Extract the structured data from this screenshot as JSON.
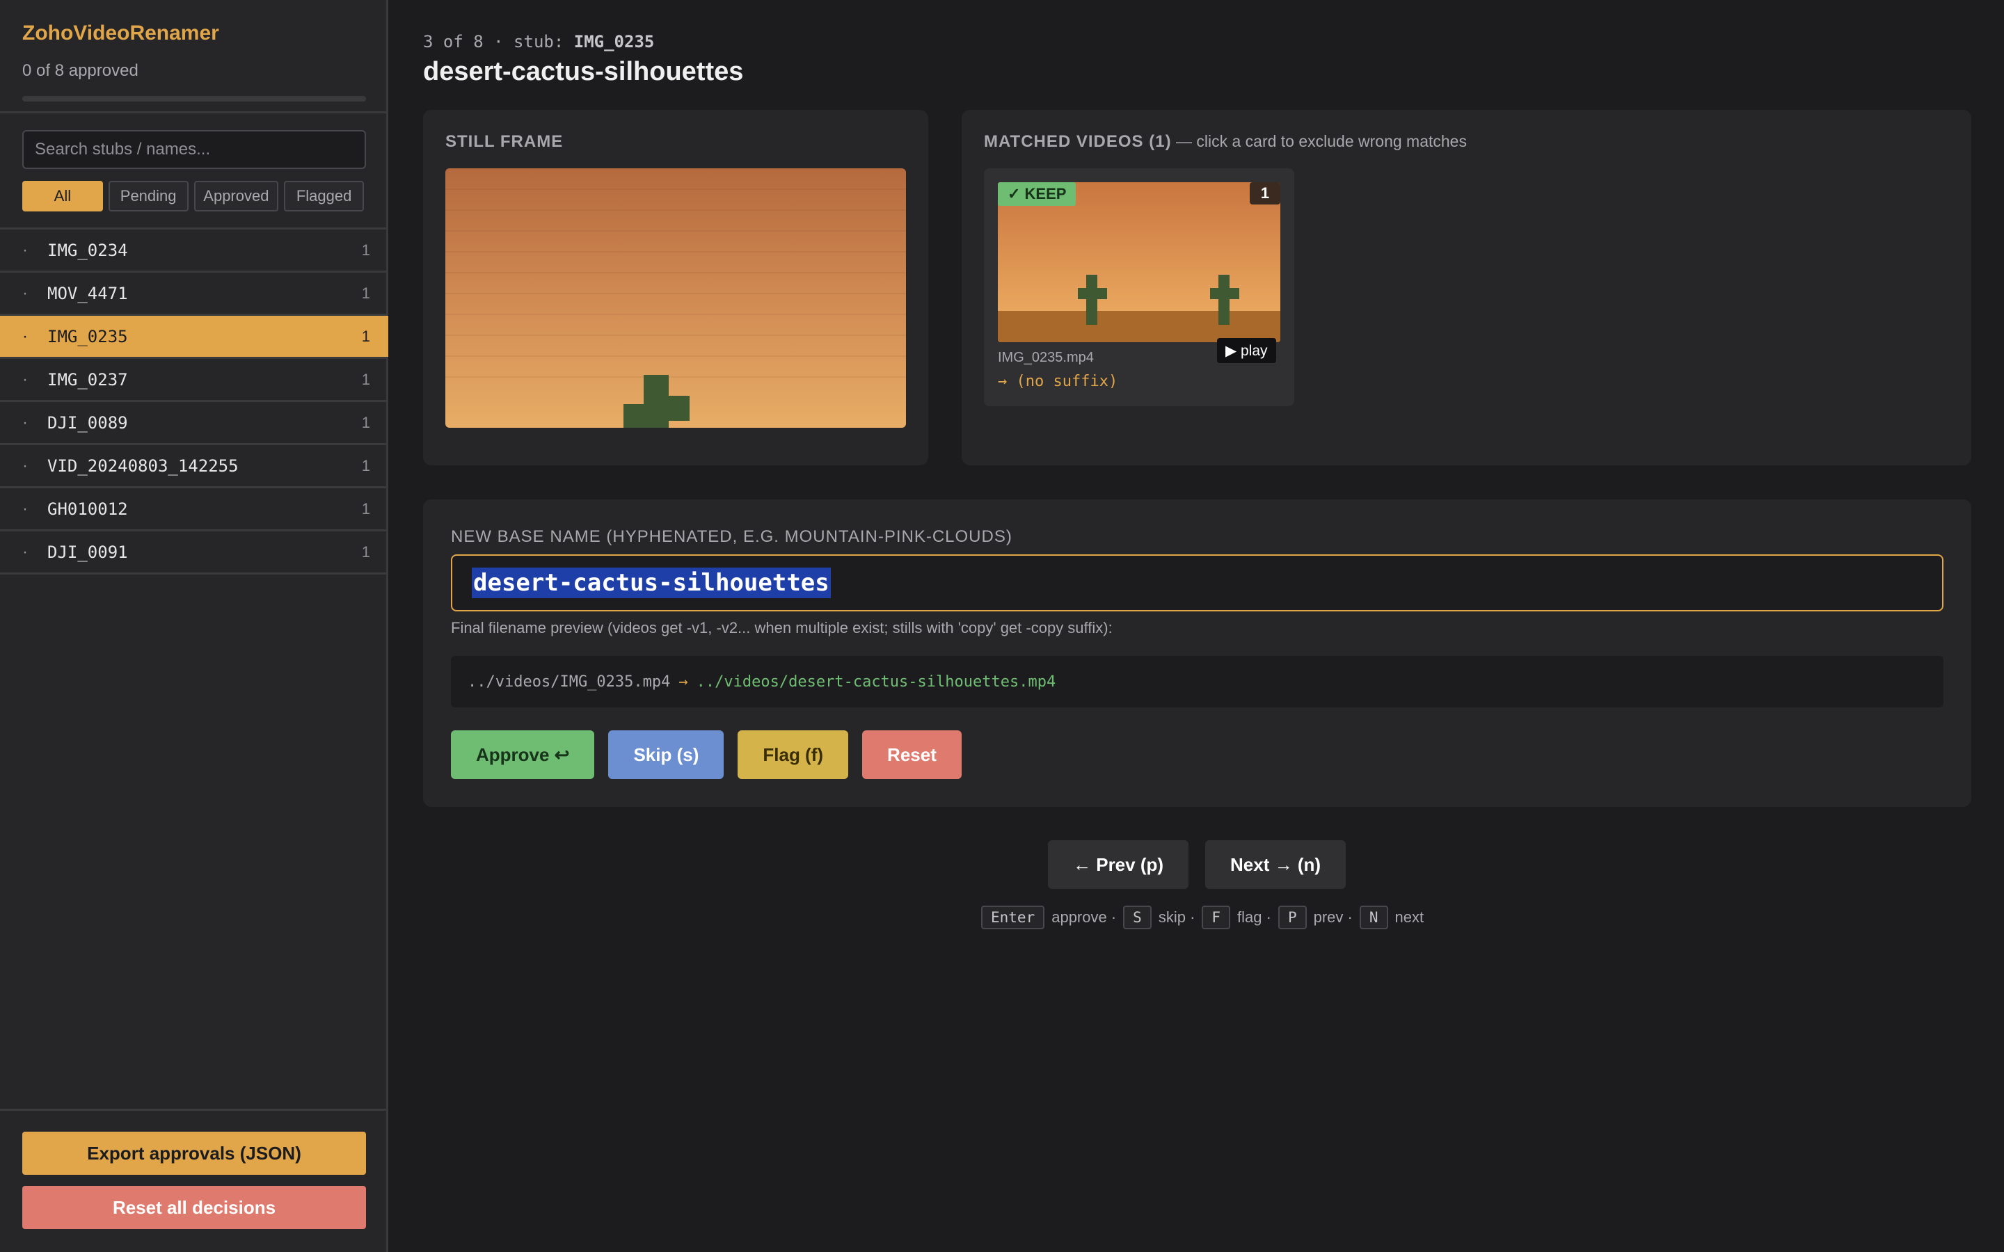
{
  "app": {
    "title": "ZohoVideoRenamer",
    "approved_text": "0 of 8 approved",
    "progress": 0
  },
  "sidebar": {
    "search_placeholder": "Search stubs / names...",
    "filters": [
      "All",
      "Pending",
      "Approved",
      "Flagged"
    ],
    "active_filter": "All",
    "items": [
      {
        "bullet": "·",
        "name": "IMG_0234",
        "count": "1"
      },
      {
        "bullet": "·",
        "name": "MOV_4471",
        "count": "1"
      },
      {
        "bullet": "·",
        "name": "IMG_0235",
        "count": "1"
      },
      {
        "bullet": "·",
        "name": "IMG_0237",
        "count": "1"
      },
      {
        "bullet": "·",
        "name": "DJI_0089",
        "count": "1"
      },
      {
        "bullet": "·",
        "name": "VID_20240803_142255",
        "count": "1"
      },
      {
        "bullet": "·",
        "name": "GH010012",
        "count": "1"
      },
      {
        "bullet": "·",
        "name": "DJI_0091",
        "count": "1"
      }
    ],
    "selected_index": 2,
    "export_label": "Export approvals (JSON)",
    "reset_all_label": "Reset all decisions"
  },
  "main": {
    "stub_prefix": "3 of 8 · stub: ",
    "stub_id": "IMG_0235",
    "title": "desert-cactus-silhouettes",
    "still_label": "STILL FRAME",
    "matched_label": "MATCHED VIDEOS (1)",
    "matched_sub": " — click a card to exclude wrong matches",
    "video": {
      "keep_label": "✓ KEEP",
      "number": "1",
      "play_label": "▶ play",
      "filename": "IMG_0235.mp4",
      "suffix": "→ (no suffix)"
    },
    "rename": {
      "label": "NEW BASE NAME (HYPHENATED, E.G. MOUNTAIN-PINK-CLOUDS)",
      "value": "desert-cactus-silhouettes",
      "preview_note": "Final filename preview (videos get -v1, -v2... when multiple exist; stills with 'copy' get -copy suffix):",
      "preview_old": "../videos/IMG_0235.mp4",
      "preview_arrow": "→",
      "preview_new": "../videos/desert-cactus-silhouettes.mp4"
    },
    "actions": {
      "approve": "Approve ↩",
      "skip": "Skip (s)",
      "flag": "Flag (f)",
      "reset": "Reset"
    },
    "nav": {
      "prev": "← Prev (p)",
      "next": "Next → (n)"
    },
    "shortcuts": [
      {
        "key": "Enter",
        "desc": "approve ·"
      },
      {
        "key": "S",
        "desc": "skip ·"
      },
      {
        "key": "F",
        "desc": "flag ·"
      },
      {
        "key": "P",
        "desc": "prev ·"
      },
      {
        "key": "N",
        "desc": "next"
      }
    ]
  },
  "colors": {
    "accent": "#e2a64a",
    "approve": "#6fbd72",
    "skip": "#6c8fd1",
    "flag": "#d4b44a",
    "reset": "#de7a6e",
    "background": "#1c1c1e",
    "panel": "#262628"
  }
}
